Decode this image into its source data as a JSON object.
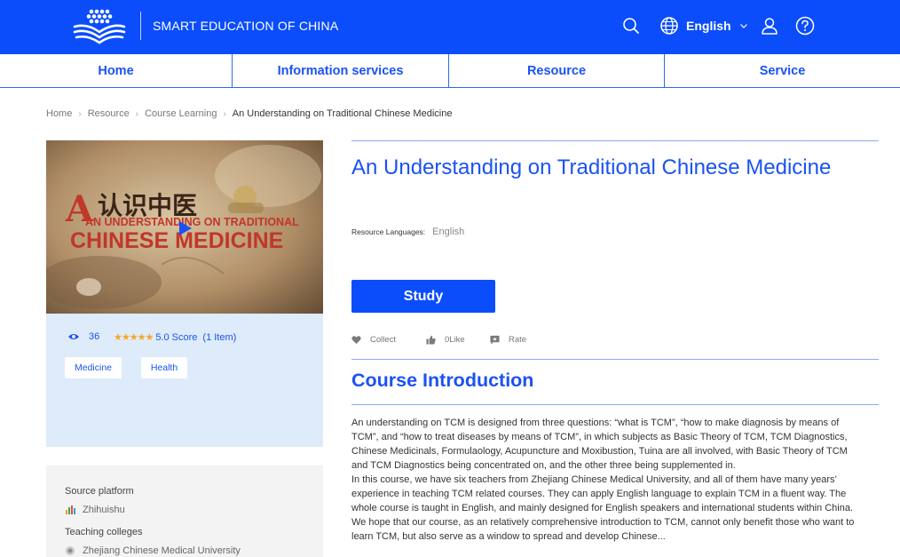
{
  "header": {
    "site_title": "SMART EDUCATION OF CHINA",
    "language": "English",
    "icons": [
      "search-icon",
      "globe-icon",
      "user-icon",
      "help-icon"
    ],
    "brand_color": "#0b4dfb"
  },
  "nav": {
    "items": [
      {
        "label": "Home"
      },
      {
        "label": "Information services"
      },
      {
        "label": "Resource"
      },
      {
        "label": "Service"
      }
    ]
  },
  "breadcrumb": {
    "items": [
      "Home",
      "Resource",
      "Course Learning"
    ],
    "current": "An Understanding on Traditional Chinese Medicine"
  },
  "cover": {
    "text_cn": "认识中医",
    "text_en_line1": "AN UNDERSTANDING ON TRADITIONAL",
    "text_en_line2": "CHINESE MEDICINE"
  },
  "stats": {
    "views": "36",
    "stars": "★★★★★",
    "score": "5.0 Score",
    "score_items": "(1 Item)",
    "tags": [
      "Medicine",
      "Health"
    ]
  },
  "source": {
    "platform_label": "Source platform",
    "platform_value": "Zhihuishu",
    "colleges_label": "Teaching colleges",
    "colleges_value": "Zhejiang Chinese Medical University"
  },
  "course": {
    "title": "An Understanding on Traditional Chinese Medicine",
    "resource_languages_label": "Resource Languages:",
    "resource_languages_value": "English",
    "study_label": "Study",
    "actions": {
      "collect": "Collect",
      "like": "0Like",
      "rate": "Rate"
    },
    "intro_heading": "Course Introduction",
    "intro_paragraphs": [
      "An understanding on TCM is designed from three questions: “what is TCM”, “how to make diagnosis by means of TCM”, and “how to treat diseases by means of TCM”, in which subjects as Basic Theory of TCM, TCM Diagnostics, Chinese Medicinals, Formulaology, Acupuncture and Moxibustion, Tuina are all involved, with Basic Theory of TCM and TCM Diagnostics being concentrated on, and the other three being supplemented in.",
      "In this course, we have six teachers from Zhejiang Chinese Medical University, and all of them have many years’ experience in teaching TCM related courses. They can apply English language to explain TCM in a fluent way. The whole course is taught in English, and mainly designed for English speakers and international students within China. We hope that our course, as an relatively comprehensive introduction to TCM, cannot only benefit those who want to learn TCM, but also serve as a window to spread and develop Chinese..."
    ]
  }
}
